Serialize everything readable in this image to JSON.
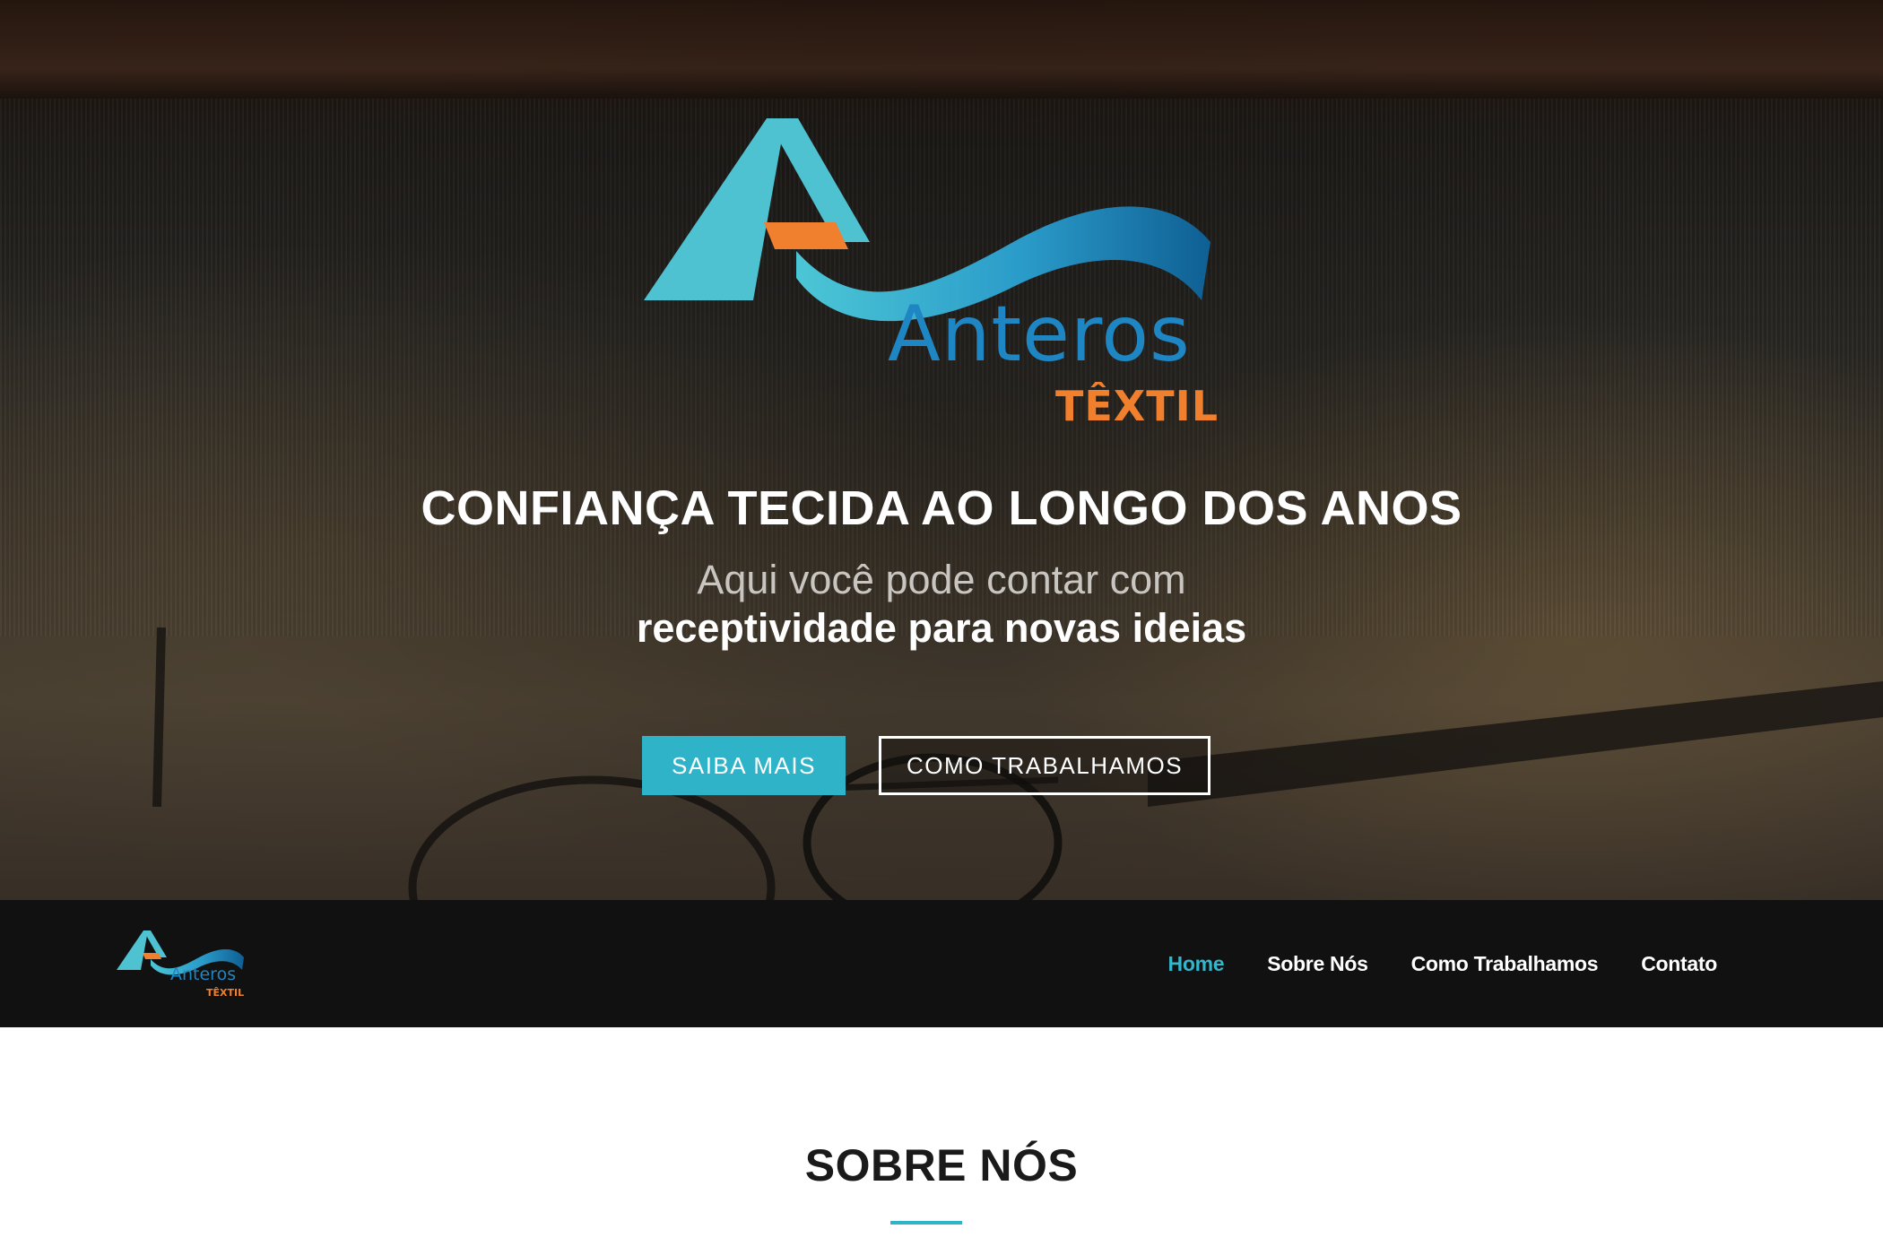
{
  "hero": {
    "logo": {
      "wordmark": "Anteros",
      "subtitle": "TÊXTIL"
    },
    "heading": "CONFIANÇA TECIDA AO LONGO DOS ANOS",
    "subheading_line1": "Aqui você pode contar com",
    "subheading_line2": "receptividade para novas ideias",
    "buttons": {
      "primary": "SAIBA MAIS",
      "secondary": "COMO TRABALHAMOS"
    }
  },
  "navbar": {
    "logo": {
      "wordmark": "Anteros",
      "subtitle": "TÊXTIL"
    },
    "items": [
      {
        "label": "Home",
        "active": true
      },
      {
        "label": "Sobre Nós",
        "active": false
      },
      {
        "label": "Como Trabalhamos",
        "active": false
      },
      {
        "label": "Contato",
        "active": false
      }
    ]
  },
  "section": {
    "title": "SOBRE NÓS"
  },
  "colors": {
    "accent": "#2fb3c9",
    "logo_blue": "#1f86c4",
    "logo_orange": "#f07f2e",
    "navbar_bg": "#111111"
  }
}
